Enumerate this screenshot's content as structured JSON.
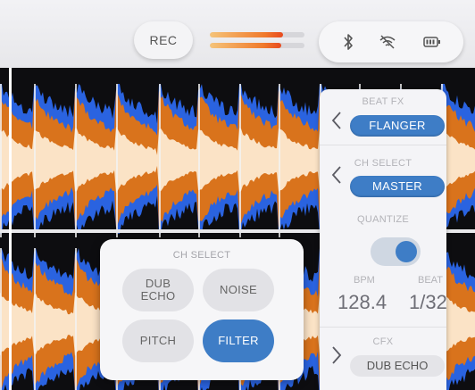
{
  "topbar": {
    "rec_label": "REC",
    "level_meters": [
      0.77,
      0.75
    ],
    "status_icons": [
      "bluetooth-icon",
      "wifi-off-icon",
      "battery-icon"
    ]
  },
  "right_panel": {
    "beat_fx": {
      "label": "BEAT FX",
      "value": "FLANGER"
    },
    "ch_select": {
      "label": "CH SELECT",
      "value": "MASTER"
    },
    "quantize": {
      "label": "QUANTIZE",
      "on": true
    },
    "bpm": {
      "label": "BPM",
      "value": "128.4"
    },
    "beat": {
      "label": "BEAT",
      "value": "1/32"
    },
    "cfx": {
      "label": "CFX",
      "value": "DUB ECHO"
    }
  },
  "ch_select_popup": {
    "title": "CH SELECT",
    "options": [
      "DUB\nECHO",
      "NOISE",
      "PITCH",
      "FILTER"
    ],
    "selected": "FILTER"
  },
  "colors": {
    "accent": "#3e7dc6",
    "wave_blue": "#2a63e0",
    "wave_orange": "#d9731c",
    "wave_cream": "#fbe3c6",
    "meter_orange": "#f07a2c"
  }
}
